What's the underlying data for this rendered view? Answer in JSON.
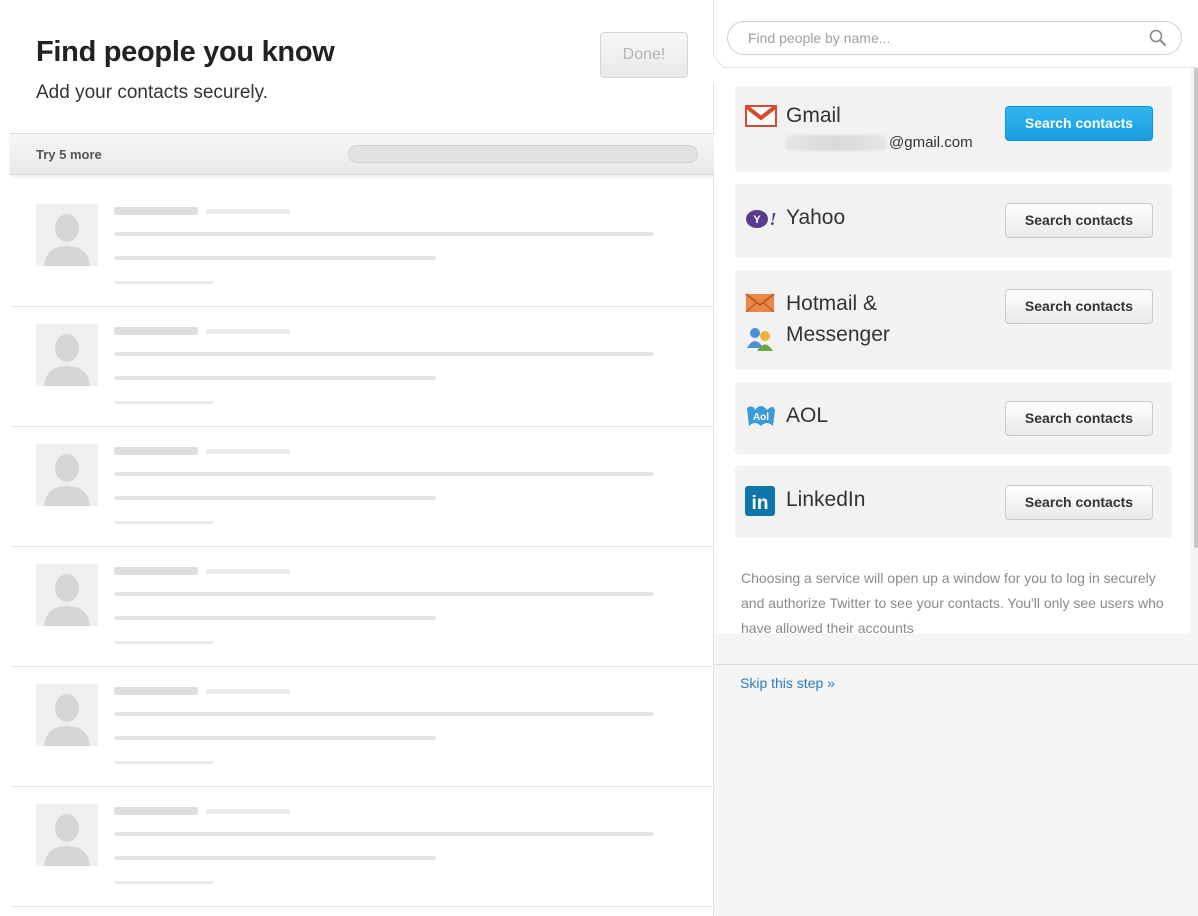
{
  "header": {
    "title": "Find people you know",
    "subtitle": "Add your contacts securely.",
    "done_label": "Done!"
  },
  "try_bar": {
    "label": "Try 5 more",
    "progress": 0
  },
  "placeholder_rows": 6,
  "search": {
    "placeholder": "Find people by name..."
  },
  "services": [
    {
      "name": "Gmail",
      "email_suffix": "@gmail.com",
      "button": "Search contacts",
      "primary": true,
      "icon": "gmail-icon"
    },
    {
      "name": "Yahoo",
      "button": "Search contacts",
      "primary": false,
      "icon": "yahoo-icon"
    },
    {
      "name": "Hotmail &",
      "name2": "Messenger",
      "button": "Search contacts",
      "primary": false,
      "icon": "hotmail-icon",
      "icon2": "messenger-icon"
    },
    {
      "name": "AOL",
      "button": "Search contacts",
      "primary": false,
      "icon": "aol-icon"
    },
    {
      "name": "LinkedIn",
      "button": "Search contacts",
      "primary": false,
      "icon": "linkedin-icon"
    }
  ],
  "help_text": "Choosing a service will open up a window for you to log in securely and authorize Twitter to see your contacts. You'll only see users who have allowed their accounts",
  "skip_label": "Skip this step »",
  "colors": {
    "primary_button": "#1a9ee0",
    "link": "#2b7bb9",
    "gmail": "#d44a2e",
    "yahoo": "#5b3a8c",
    "linkedin": "#0e76a8"
  }
}
